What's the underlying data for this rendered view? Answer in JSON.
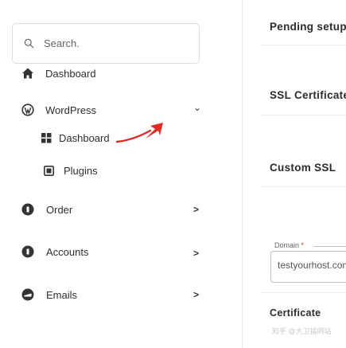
{
  "sidebar": {
    "search": {
      "placeholder": "Search.",
      "icon": "search-icon"
    },
    "items": [
      {
        "label": "Dashboard",
        "icon": "home-icon"
      },
      {
        "label": "WordPress",
        "icon": "wordpress-icon",
        "chevron": "⌄"
      },
      {
        "label": "Dashboard",
        "icon": "dashboard-grid-icon",
        "annotation": "red-arrow-icon"
      },
      {
        "label": "Plugins",
        "icon": "plugin-icon"
      },
      {
        "label": "Order",
        "icon": "order-icon",
        "chevron": ">"
      },
      {
        "label": "Accounts",
        "icon": "accounts-icon",
        "chevron": ">"
      },
      {
        "label": "Emails",
        "icon": "email-icon",
        "chevron": ">"
      }
    ]
  },
  "main": {
    "sections": [
      {
        "title": "Pending setup"
      },
      {
        "title": "SSL Certificate"
      },
      {
        "title": "Custom SSL"
      },
      {
        "title": "Certificate"
      }
    ],
    "domain_field": {
      "legend": "Domain",
      "required_mark": "*",
      "value": "testyourhost.com"
    }
  },
  "watermark": "知乎 @大卫搞网站",
  "colors": {
    "accent_arrow": "#e02b2b",
    "divider": "#e6e6e6"
  }
}
